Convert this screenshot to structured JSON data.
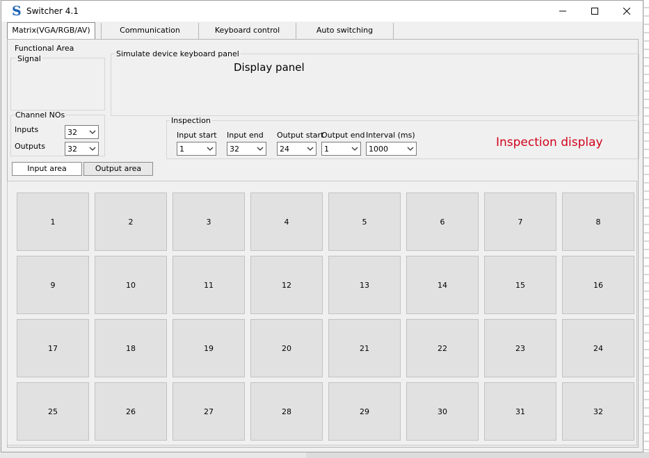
{
  "window": {
    "title": "Switcher 4.1",
    "app_icon_letter": "S"
  },
  "tabs": [
    {
      "label": "Matrix(VGA/RGB/AV)",
      "active": true
    },
    {
      "label": "Communication",
      "active": false
    },
    {
      "label": "Keyboard control",
      "active": false
    },
    {
      "label": "Auto switching",
      "active": false
    }
  ],
  "functional_area": {
    "label": "Functional Area",
    "signal_label": "Signal"
  },
  "keyboard_panel": {
    "label": "Simulate device keyboard panel",
    "display_text": "Display panel"
  },
  "channel_nos": {
    "label": "Channel NOs",
    "inputs_label": "Inputs",
    "inputs_value": "32",
    "outputs_label": "Outputs",
    "outputs_value": "32"
  },
  "inspection": {
    "label": "Inspection",
    "input_start_label": "Input start",
    "input_start_value": "1",
    "input_end_label": "Input end",
    "input_end_value": "32",
    "output_start_label": "Output start",
    "output_start_value": "24",
    "output_end_label": "Output end",
    "output_end_value": "1",
    "interval_label": "Interval (ms)",
    "interval_value": "1000",
    "display_text": "Inspection display",
    "display_color": "#d0021b"
  },
  "area_tabs": [
    {
      "label": "Input area",
      "active": true
    },
    {
      "label": "Output area",
      "active": false
    }
  ],
  "channel_buttons": [
    "1",
    "2",
    "3",
    "4",
    "5",
    "6",
    "7",
    "8",
    "9",
    "10",
    "11",
    "12",
    "13",
    "14",
    "15",
    "16",
    "17",
    "18",
    "19",
    "20",
    "21",
    "22",
    "23",
    "24",
    "25",
    "26",
    "27",
    "28",
    "29",
    "30",
    "31",
    "32"
  ],
  "colors": {
    "accent_icon": "#1f63b7",
    "window_bg": "#f0f0f0",
    "button_face": "#e1e1e1"
  }
}
